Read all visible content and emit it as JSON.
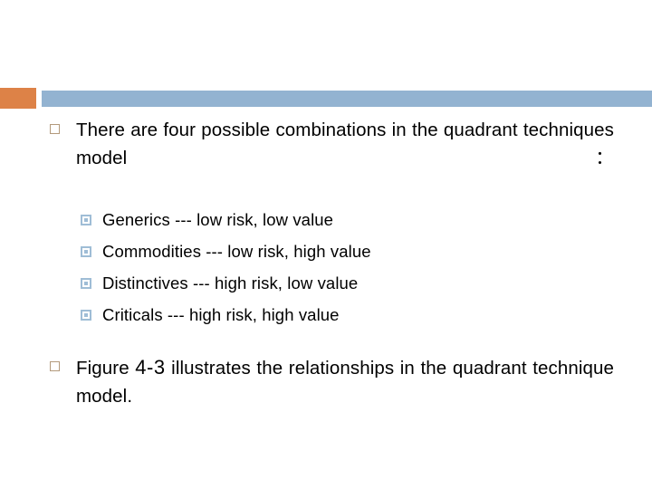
{
  "slide": {
    "decor": {
      "orange_color": "#dd8247",
      "blue_color": "#93b3d1"
    },
    "bullets": [
      {
        "id": "intro",
        "glyph": "hollow-square",
        "text_before": "There are four possible combinations in the quadrant techniques model",
        "figure_ref": "",
        "text_after": "："
      },
      {
        "id": "figure",
        "glyph": "hollow-square",
        "text_before": "Figure ",
        "figure_ref": "4-3",
        "text_after": " illustrates the relationships in the quadrant technique model."
      }
    ],
    "subbullets": [
      {
        "glyph": "box-dot",
        "text": "Generics --- low risk, low value"
      },
      {
        "glyph": "box-dot",
        "text": "Commodities --- low risk, high value"
      },
      {
        "glyph": "box-dot",
        "text": "Distinctives --- high risk, low value"
      },
      {
        "glyph": "box-dot",
        "text": "Criticals --- high risk, high value"
      }
    ]
  }
}
